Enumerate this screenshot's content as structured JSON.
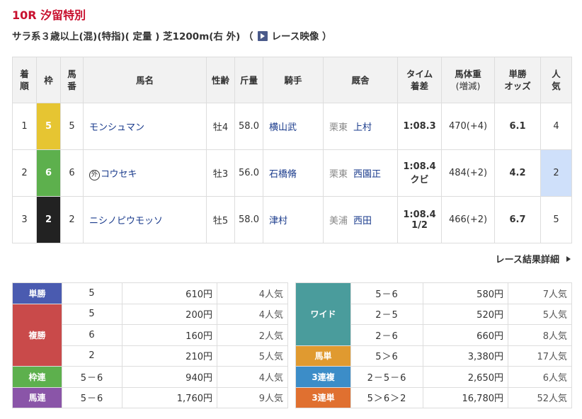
{
  "race": {
    "title": "10R 汐留特別",
    "conditions": "サラ系３歳以上(混)(特指)( 定量 ) 芝1200m(右 外) （",
    "video_label": "レース映像",
    "closing": "）"
  },
  "headers": {
    "rank": [
      "着",
      "順"
    ],
    "waku": "枠",
    "uma": [
      "馬",
      "番"
    ],
    "name": "馬名",
    "sexage": "性齢",
    "weight": "斤量",
    "jockey": "騎手",
    "stable": "厩舎",
    "time": [
      "タイム",
      "着差"
    ],
    "body": [
      "馬体重",
      "(増減)"
    ],
    "odds": [
      "単勝",
      "オッズ"
    ],
    "pop": [
      "人",
      "気"
    ]
  },
  "rows": [
    {
      "rank": "1",
      "waku": "5",
      "uma": "5",
      "gaiko": "",
      "name": "モンシュマン",
      "sexage": "牡4",
      "weight": "58.0",
      "jockey": "横山武",
      "area": "栗東",
      "trainer": "上村",
      "time": "1:08.3",
      "margin": "",
      "body": "470(+4)",
      "odds": "6.1",
      "pop": "4"
    },
    {
      "rank": "2",
      "waku": "6",
      "uma": "6",
      "gaiko": "外",
      "name": "コウセキ",
      "sexage": "牡3",
      "weight": "56.0",
      "jockey": "石橋脩",
      "area": "栗東",
      "trainer": "西園正",
      "time": "1:08.4",
      "margin": "クビ",
      "body": "484(+2)",
      "odds": "4.2",
      "pop": "2"
    },
    {
      "rank": "3",
      "waku": "2",
      "uma": "2",
      "gaiko": "",
      "name": "ニシノピウモッソ",
      "sexage": "牡5",
      "weight": "58.0",
      "jockey": "津村",
      "area": "美浦",
      "trainer": "西田",
      "time": "1:08.4",
      "margin": "1/2",
      "body": "466(+2)",
      "odds": "6.7",
      "pop": "5"
    }
  ],
  "detail_link": "レース結果詳細",
  "payouts_left": {
    "tansho": {
      "label": "単勝",
      "combo": "5",
      "amount": "610円",
      "pop": "4人気"
    },
    "fukusho": {
      "label": "複勝",
      "entries": [
        {
          "combo": "5",
          "amount": "200円",
          "pop": "4人気"
        },
        {
          "combo": "6",
          "amount": "160円",
          "pop": "2人気"
        },
        {
          "combo": "2",
          "amount": "210円",
          "pop": "5人気"
        }
      ]
    },
    "wakuren": {
      "label": "枠連",
      "combo": "5－6",
      "amount": "940円",
      "pop": "4人気"
    },
    "umaren": {
      "label": "馬連",
      "combo": "5－6",
      "amount": "1,760円",
      "pop": "9人気"
    }
  },
  "payouts_right": {
    "wide": {
      "label": "ワイド",
      "entries": [
        {
          "combo": "5－6",
          "amount": "580円",
          "pop": "7人気"
        },
        {
          "combo": "2－5",
          "amount": "520円",
          "pop": "5人気"
        },
        {
          "combo": "2－6",
          "amount": "660円",
          "pop": "8人気"
        }
      ]
    },
    "umatan": {
      "label": "馬単",
      "combo": "5＞6",
      "amount": "3,380円",
      "pop": "17人気"
    },
    "sanrenpuku": {
      "label": "3連複",
      "combo": "2－5－6",
      "amount": "2,650円",
      "pop": "6人気"
    },
    "sanrentan": {
      "label": "3連単",
      "combo": "5＞6＞2",
      "amount": "16,780円",
      "pop": "52人気"
    }
  },
  "colors": {
    "title": "#c8102e",
    "link": "#1a3b8c",
    "favorite": "#cfe0fa"
  }
}
